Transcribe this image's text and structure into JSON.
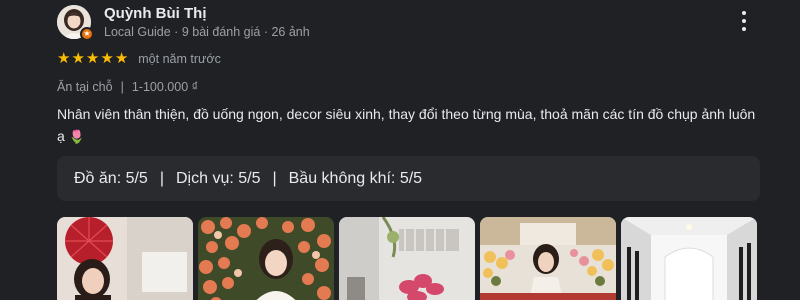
{
  "author": {
    "name": "Quỳnh Bùi Thị",
    "meta": "Local Guide · 9 bài đánh giá · 26 ảnh",
    "badge_icon": "local-guide-star-icon"
  },
  "rating": {
    "stars": 5,
    "max": 5,
    "time": "một năm trước",
    "star_color": "#fbbc04"
  },
  "attributes": {
    "service_type": "Ăn tại chỗ",
    "price": "1-100.000 ₫"
  },
  "review": {
    "text": "Nhân viên thân thiện, đồ uống ngon, decor siêu xinh, thay đổi theo từng mùa, thoả mãn các tín đồ chụp ảnh luôn ạ",
    "emoji": "🌷"
  },
  "scores": {
    "food": "Đồ ăn: 5/5",
    "service": "Dịch vụ: 5/5",
    "atmosphere": "Bầu không khí: 5/5",
    "separator": "|"
  },
  "photos": [
    {
      "name": "photo-1"
    },
    {
      "name": "photo-2"
    },
    {
      "name": "photo-3"
    },
    {
      "name": "photo-4"
    },
    {
      "name": "photo-5"
    }
  ],
  "colors": {
    "background": "#202124",
    "secondary_text": "#9aa0a6",
    "score_box": "#2a2b2e",
    "guide_badge": "#e8710a"
  }
}
